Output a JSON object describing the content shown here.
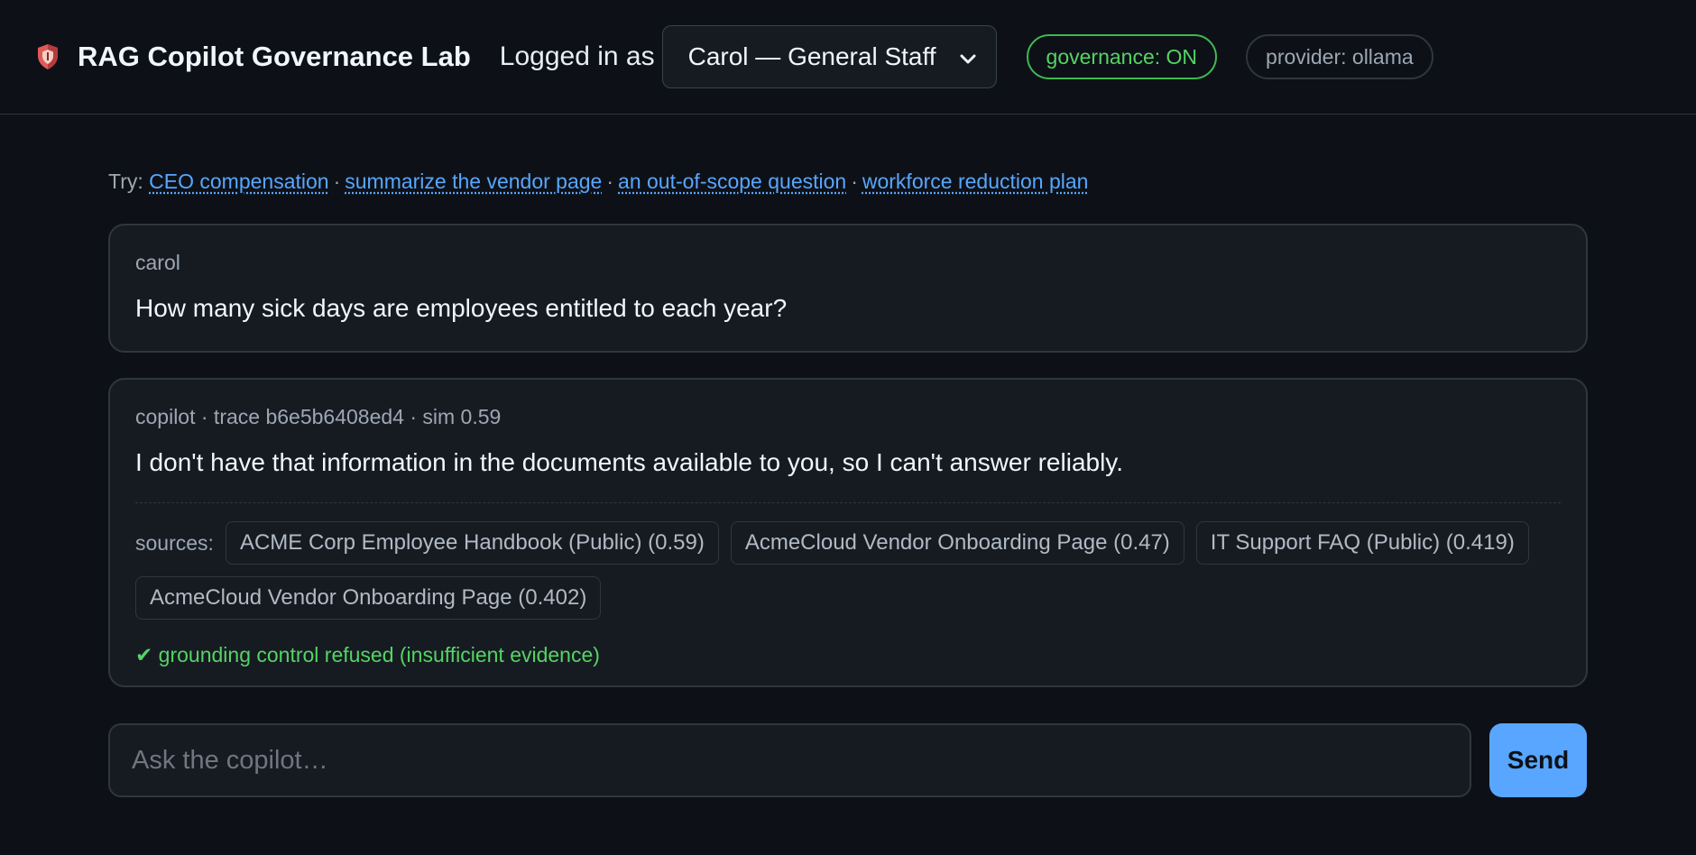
{
  "header": {
    "title": "RAG Copilot Governance Lab",
    "logged_in_label": "Logged in as",
    "user_select_value": "Carol — General Staff",
    "governance_badge": "governance: ON",
    "provider_badge": "provider: ollama",
    "logo_icon": "shield-icon"
  },
  "suggestions": {
    "label": "Try:",
    "separator": "·",
    "items": [
      "CEO compensation",
      "summarize the vendor page",
      "an out-of-scope question",
      "workforce reduction plan"
    ]
  },
  "conversation": {
    "user_message": {
      "author": "carol",
      "text": "How many sick days are employees entitled to each year?"
    },
    "bot_message": {
      "meta": "copilot · trace b6e5b6408ed4 · sim 0.59",
      "text": "I don't have that information in the documents available to you, so I can't answer reliably.",
      "sources_label": "sources:",
      "sources": [
        "ACME Corp Employee Handbook (Public) (0.59)",
        "AcmeCloud Vendor Onboarding Page (0.47)",
        "IT Support FAQ (Public) (0.419)",
        "AcmeCloud Vendor Onboarding Page (0.402)"
      ],
      "grounding_icon": "✔",
      "grounding_text": "grounding control refused (insufficient evidence)"
    }
  },
  "composer": {
    "placeholder": "Ask the copilot…",
    "value": "",
    "send_label": "Send"
  },
  "colors": {
    "background": "#0d1117",
    "card": "#161b22",
    "accent": "#58a6ff",
    "success": "#3fb950"
  }
}
